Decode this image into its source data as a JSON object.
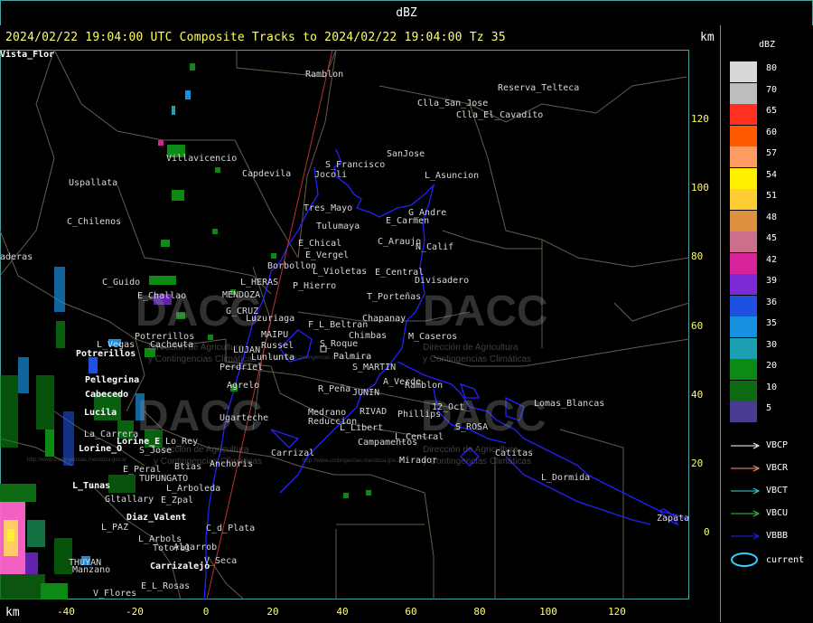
{
  "window": {
    "title": "dBZ"
  },
  "header": {
    "headline": "2024/02/22 19:04:00 UTC Composite Tracks to 2024/02/22 19:04:00 Tz 35",
    "km_top": "km",
    "km_bottom": "km"
  },
  "axes": {
    "right_ticks": [
      "120",
      "100",
      "80",
      "60",
      "40",
      "20",
      "0"
    ],
    "bottom_ticks": [
      "-40",
      "-20",
      "0",
      "20",
      "40",
      "60",
      "80",
      "100",
      "120"
    ]
  },
  "legend": {
    "title": "dBZ",
    "scale": [
      {
        "label": "80",
        "color": "#d8d8d8"
      },
      {
        "label": "70",
        "color": "#bdbdbd"
      },
      {
        "label": "65",
        "color": "#ff3020"
      },
      {
        "label": "60",
        "color": "#ff5a00"
      },
      {
        "label": "57",
        "color": "#ff9a60"
      },
      {
        "label": "54",
        "color": "#fff000"
      },
      {
        "label": "51",
        "color": "#ffcc33"
      },
      {
        "label": "48",
        "color": "#dd9040"
      },
      {
        "label": "45",
        "color": "#cc6f8a"
      },
      {
        "label": "42",
        "color": "#d6229b"
      },
      {
        "label": "39",
        "color": "#7b2ad6"
      },
      {
        "label": "36",
        "color": "#2050e0"
      },
      {
        "label": "35",
        "color": "#1890e0"
      },
      {
        "label": "30",
        "color": "#1aa0b0"
      },
      {
        "label": "20",
        "color": "#0c8a14"
      },
      {
        "label": "10",
        "color": "#0e6a12"
      },
      {
        "label": "5",
        "color": "#4a3a90"
      }
    ],
    "tracks": [
      {
        "label": "VBCP",
        "color": "#ffffff"
      },
      {
        "label": "VBCR",
        "color": "#ff9966"
      },
      {
        "label": "VBCT",
        "color": "#33dddd"
      },
      {
        "label": "VBCU",
        "color": "#33cc33"
      },
      {
        "label": "VBBB",
        "color": "#2222ff"
      }
    ],
    "current": {
      "label": "current",
      "color": "#33ccff"
    }
  },
  "watermark": {
    "brand": "DACC",
    "line1": "Dirección de Agricultura",
    "line2": "y Contingencias Climáticas",
    "url": "http://www.contingencias.mendoza.gov.ar"
  },
  "places": [
    {
      "name": "Ramblon",
      "style": "g"
    },
    {
      "name": "Reserva_Telteca",
      "style": "g"
    },
    {
      "name": "Clla_San_Jose",
      "style": "g"
    },
    {
      "name": "Clla_El_Cavadito",
      "style": "g"
    },
    {
      "name": "Villavicencio",
      "style": "g"
    },
    {
      "name": "Capdevila",
      "style": "g"
    },
    {
      "name": "S_Francisco",
      "style": "g"
    },
    {
      "name": "SanJose",
      "style": "g"
    },
    {
      "name": "Uspallata",
      "style": "g"
    },
    {
      "name": "Jocoli",
      "style": "g"
    },
    {
      "name": "L_Asuncion",
      "style": "g"
    },
    {
      "name": "Tres_Mayo",
      "style": "g"
    },
    {
      "name": "G_Andre",
      "style": "g"
    },
    {
      "name": "E_Carmen",
      "style": "g"
    },
    {
      "name": "C_Chilenos",
      "style": "g"
    },
    {
      "name": "Tulumaya",
      "style": "g"
    },
    {
      "name": "E_Chical",
      "style": "g"
    },
    {
      "name": "C_Araujo",
      "style": "g"
    },
    {
      "name": "N_Calif",
      "style": "g"
    },
    {
      "name": "E_Vergel",
      "style": "g"
    },
    {
      "name": "aderas",
      "style": "g"
    },
    {
      "name": "Borbollon",
      "style": "g"
    },
    {
      "name": "L_Violetas",
      "style": "g"
    },
    {
      "name": "E_Central",
      "style": "g"
    },
    {
      "name": "C_Guido",
      "style": "g"
    },
    {
      "name": "L_HERAS",
      "style": "g"
    },
    {
      "name": "P_Hierro",
      "style": "g"
    },
    {
      "name": "Divisadero",
      "style": "g"
    },
    {
      "name": "E_Challao",
      "style": "g"
    },
    {
      "name": "MENDOZA",
      "style": "g"
    },
    {
      "name": "T_Porteñas",
      "style": "g"
    },
    {
      "name": "G_CRUZ",
      "style": "g"
    },
    {
      "name": "Luzuriaga",
      "style": "g"
    },
    {
      "name": "F_L_Beltran",
      "style": "g"
    },
    {
      "name": "Chapanay",
      "style": "g"
    },
    {
      "name": "Potrerillos",
      "style": "g"
    },
    {
      "name": "MAIPU",
      "style": "g"
    },
    {
      "name": "Chimbas",
      "style": "g"
    },
    {
      "name": "M_Caseros",
      "style": "g"
    },
    {
      "name": "L_Vegas",
      "style": "g"
    },
    {
      "name": "Cacheuta",
      "style": "g"
    },
    {
      "name": "Russel",
      "style": "g"
    },
    {
      "name": "S_Roque",
      "style": "g"
    },
    {
      "name": "LUJAN",
      "style": "g"
    },
    {
      "name": "Potrerillos",
      "style": "w"
    },
    {
      "name": "Lunlunta",
      "style": "g"
    },
    {
      "name": "Palmira",
      "style": "g"
    },
    {
      "name": "Perdriel",
      "style": "g"
    },
    {
      "name": "S_MARTIN",
      "style": "g"
    },
    {
      "name": "Pellegrina",
      "style": "w"
    },
    {
      "name": "A_Verde",
      "style": "g"
    },
    {
      "name": "Ramblon",
      "style": "g"
    },
    {
      "name": "Agrelo",
      "style": "g"
    },
    {
      "name": "R_Peña",
      "style": "g"
    },
    {
      "name": "JUNIN",
      "style": "g"
    },
    {
      "name": "Cabecedo",
      "style": "w"
    },
    {
      "name": "Lomas_Blancas",
      "style": "g"
    },
    {
      "name": "12_Oct",
      "style": "g"
    },
    {
      "name": "Lucila",
      "style": "w"
    },
    {
      "name": "Ugarteche",
      "style": "g"
    },
    {
      "name": "Medrano",
      "style": "g"
    },
    {
      "name": "RIVAD",
      "style": "g"
    },
    {
      "name": "Phillips",
      "style": "g"
    },
    {
      "name": "Reduccion",
      "style": "g"
    },
    {
      "name": "L_Libert",
      "style": "g"
    },
    {
      "name": "S_ROSA",
      "style": "g"
    },
    {
      "name": "La_Carrera",
      "style": "g"
    },
    {
      "name": "L_Central",
      "style": "g"
    },
    {
      "name": "Campamentos",
      "style": "g"
    },
    {
      "name": "Lorine_E",
      "style": "w"
    },
    {
      "name": "Lo_Rey",
      "style": "g"
    },
    {
      "name": "Lorine_O",
      "style": "w"
    },
    {
      "name": "S_Jose",
      "style": "g"
    },
    {
      "name": "Carrizal",
      "style": "g"
    },
    {
      "name": "Catitas",
      "style": "g"
    },
    {
      "name": "Mirador",
      "style": "g"
    },
    {
      "name": "E_Peral",
      "style": "g"
    },
    {
      "name": "Anchoris",
      "style": "g"
    },
    {
      "name": "Btias",
      "style": "g"
    },
    {
      "name": "L_Dormida",
      "style": "g"
    },
    {
      "name": "TUPUNGATO",
      "style": "g"
    },
    {
      "name": "L_Tunas",
      "style": "w"
    },
    {
      "name": "L_Arboleda",
      "style": "g"
    },
    {
      "name": "Gltallary",
      "style": "g"
    },
    {
      "name": "E_Zpal",
      "style": "g"
    },
    {
      "name": "Diaz_Valent",
      "style": "w"
    },
    {
      "name": "C_d_Plata",
      "style": "g"
    },
    {
      "name": "Zapata",
      "style": "g"
    },
    {
      "name": "L_PAZ",
      "style": "g"
    },
    {
      "name": "L_Arbols",
      "style": "g"
    },
    {
      "name": "Algarrob",
      "style": "g"
    },
    {
      "name": "Totoral",
      "style": "g"
    },
    {
      "name": "V_Seca",
      "style": "g"
    },
    {
      "name": "THUYAN",
      "style": "g"
    },
    {
      "name": "Manzano",
      "style": "g"
    },
    {
      "name": "Carrizalejo",
      "style": "w"
    },
    {
      "name": "E_L_Rosas",
      "style": "g"
    },
    {
      "name": "V_Flores",
      "style": "g"
    },
    {
      "name": "Vista_Flor",
      "style": "w"
    }
  ]
}
